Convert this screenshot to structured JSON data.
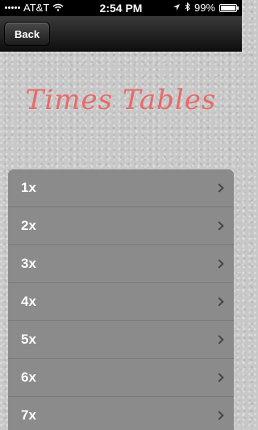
{
  "status_bar": {
    "carrier": "AT&T",
    "time": "2:54 PM",
    "battery": "99%",
    "battery_level": 0.99
  },
  "nav": {
    "back_label": "Back"
  },
  "title": "Times Tables",
  "rows": [
    {
      "label": "1x"
    },
    {
      "label": "2x"
    },
    {
      "label": "3x"
    },
    {
      "label": "4x"
    },
    {
      "label": "5x"
    },
    {
      "label": "6x"
    },
    {
      "label": "7x"
    }
  ],
  "colors": {
    "title": "#e86a6a",
    "row_bg": "#8b8b8b"
  }
}
